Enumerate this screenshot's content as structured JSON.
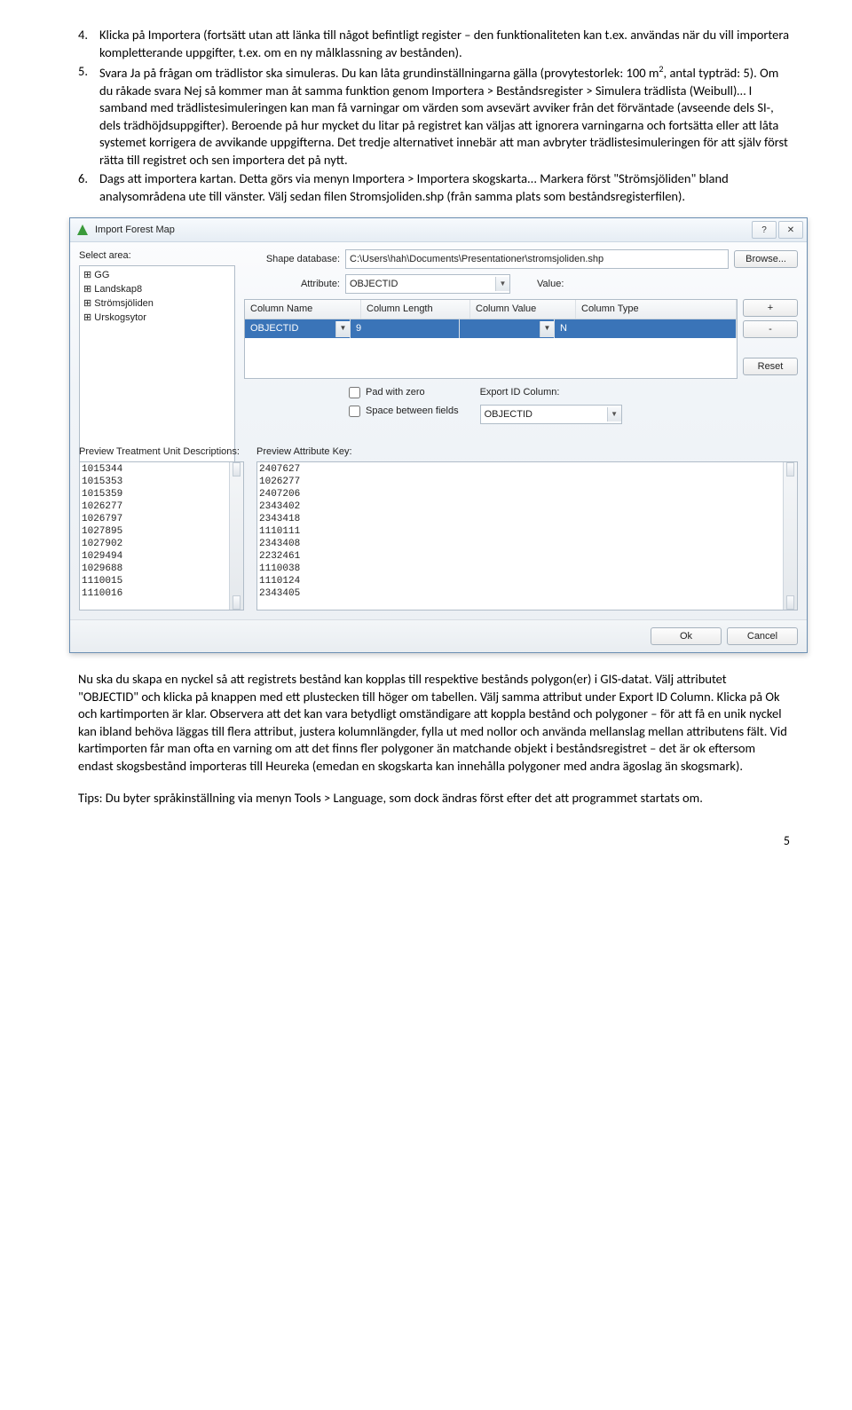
{
  "list": {
    "item4": {
      "num": "4.",
      "text": "Klicka på Importera (fortsätt utan att länka till något befintligt register – den funktionaliteten kan t.ex. användas när du vill importera kompletterande uppgifter, t.ex. om en ny målklassning av bestånden)."
    },
    "item5": {
      "num": "5.",
      "text_pre": "Svara Ja på frågan om trädlistor ska simuleras. Du kan låta grundinställningarna gälla (provytestorlek: 100 m",
      "text_sup": "2",
      "text_post": ", antal typträd: 5). Om du råkade svara Nej så kommer man åt samma funktion genom Importera > Beståndsregister > Simulera trädlista (Weibull)… I samband med trädlistesimuleringen kan man få varningar om värden som avsevärt avviker från det förväntade (avseende dels SI-, dels trädhöjdsuppgifter). Beroende på hur mycket du litar på registret kan väljas att ignorera varningarna och fortsätta eller att låta systemet korrigera de avvikande uppgifterna. Det tredje alternativet innebär att man avbryter trädlistesimuleringen för att själv först rätta till registret och sen importera det på nytt."
    },
    "item6": {
      "num": "6.",
      "text": "Dags att importera kartan. Detta görs via menyn Importera > Importera skogskarta... Markera först \"Strömsjöliden\" bland analysområdena ute till vänster. Välj sedan filen Stromsjoliden.shp (från samma plats som beståndsregisterfilen)."
    }
  },
  "dialog": {
    "title": "Import Forest Map",
    "help_glyph": "?",
    "close_glyph": "✕",
    "select_area_label": "Select area:",
    "tree": [
      "GG",
      "Landskap8",
      "Strömsjöliden",
      "Urskogsytor"
    ],
    "tree_marker": "⊞",
    "shape_db_label": "Shape database:",
    "shape_db_value": "C:\\Users\\hah\\Documents\\Presentationer\\stromsjoliden.shp",
    "browse": "Browse...",
    "attribute_label": "Attribute:",
    "attribute_value": "OBJECTID",
    "value_label": "Value:",
    "grid": {
      "h1": "Column Name",
      "h2": "Column Length",
      "h3": "Column Value",
      "h4": "Column Type",
      "r1c1": "OBJECTID",
      "r1c2": "9",
      "r1c4": "N"
    },
    "plus": "+",
    "minus": "-",
    "reset": "Reset",
    "pad_zero": "Pad with zero",
    "space_fields": "Space between fields",
    "export_id_label": "Export ID Column:",
    "export_id_value": "OBJECTID",
    "ptu_label": "Preview Treatment Unit Descriptions:",
    "attr_key_label": "Preview Attribute Key:",
    "ptu_list": [
      "1015344",
      "1015353",
      "1015359",
      "1026277",
      "1026797",
      "1027895",
      "1027902",
      "1029494",
      "1029688",
      "1110015",
      "1110016"
    ],
    "key_list": [
      "2407627",
      "1026277",
      "2407206",
      "2343402",
      "2343418",
      "1110111",
      "2343408",
      "2232461",
      "1110038",
      "1110124",
      "2343405"
    ],
    "ok": "Ok",
    "cancel": "Cancel"
  },
  "para1": "Nu ska du skapa en nyckel så att registrets bestånd kan kopplas till respektive bestånds polygon(er) i GIS-datat. Välj attributet \"OBJECTID\" och klicka på knappen med ett plustecken till höger om tabellen. Välj samma attribut under Export ID Column. Klicka på Ok och kartimporten är klar. Observera att det kan vara betydligt omständigare att koppla bestånd och polygoner – för att få en unik nyckel kan ibland behöva läggas till flera attribut, justera kolumnlängder, fylla ut med nollor och använda mellanslag mellan attributens fält. Vid kartimporten får man ofta en varning om att det finns fler polygoner än matchande objekt i beståndsregistret – det är ok eftersom endast skogsbestånd importeras till Heureka (emedan en skogskarta kan innehålla polygoner med andra ägoslag än skogsmark).",
  "para2": "Tips: Du byter språkinställning via menyn Tools > Language, som dock ändras först efter det att programmet startats om.",
  "pagenum": "5"
}
